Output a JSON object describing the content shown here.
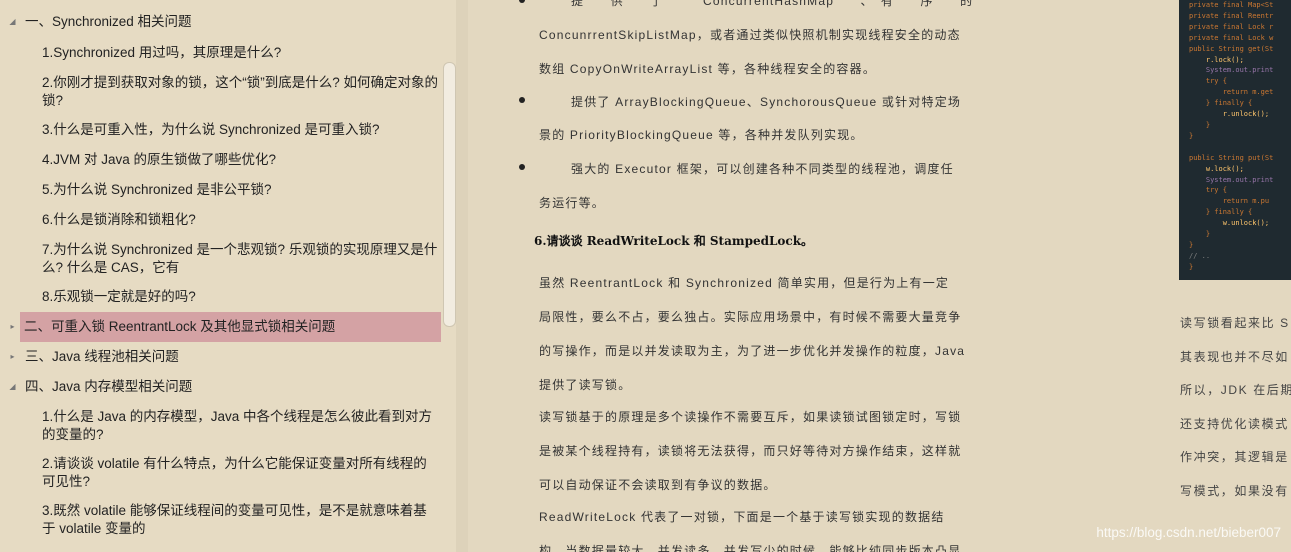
{
  "toc": {
    "sections": [
      {
        "label": "一、Synchronized 相关问题",
        "expanded": true
      },
      {
        "label": "二、可重入锁 ReentrantLock 及其他显式锁相关问题",
        "expanded": false,
        "active": true
      },
      {
        "label": "三、Java 线程池相关问题",
        "expanded": false
      },
      {
        "label": "四、Java 内存模型相关问题",
        "expanded": true
      }
    ],
    "section1_items": [
      "1.Synchronized 用过吗，其原理是什么?",
      "2.你刚才提到获取对象的锁，这个“锁”到底是什么? 如何确定对象的锁?",
      "3.什么是可重入性，为什么说 Synchronized 是可重入锁?",
      "4.JVM 对 Java 的原生锁做了哪些优化?",
      "5.为什么说 Synchronized 是非公平锁?",
      "6.什么是锁消除和锁粗化?",
      "7.为什么说 Synchronized 是一个悲观锁? 乐观锁的实现原理又是什么? 什么是 CAS，它有",
      "8.乐观锁一定就是好的吗?"
    ],
    "section4_items": [
      "1.什么是 Java 的内存模型，Java 中各个线程是怎么彼此看到对方的变量的?",
      "2.请谈谈 volatile 有什么特点，为什么它能保证变量对所有线程的可见性?",
      "3.既然 volatile 能够保证线程间的变量可见性，是不是就意味着基于 volatile 变量的"
    ]
  },
  "document": {
    "bullet1": [
      "提　　供　　了　　　ConcurrentHashMap　　、　有　　序　　的",
      "ConcunrrentSkipListMap，或者通过类似快照机制实现线程安全的动态",
      "数组 CopyOnWriteArrayList 等，各种线程安全的容器。"
    ],
    "bullet2": [
      "提供了 ArrayBlockingQueue、SynchorousQueue 或针对特定场",
      "景的 PriorityBlockingQueue 等，各种并发队列实现。"
    ],
    "bullet3": [
      "强大的 Executor 框架，可以创建各种不同类型的线程池，调度任",
      "务运行等。"
    ],
    "heading": "6.请谈谈 ReadWriteLock 和 StampedLock。",
    "para1": [
      "虽然 ReentrantLock 和 Synchronized 简单实用，但是行为上有一定",
      "局限性，要么不占，要么独占。实际应用场景中，有时候不需要大量竞争",
      "的写操作，而是以并发读取为主，为了进一步优化并发操作的粒度，Java",
      "提供了读写锁。"
    ],
    "para2": [
      "读写锁基于的原理是多个读操作不需要互斥，如果读锁试图锁定时，写锁",
      "是被某个线程持有，读锁将无法获得，而只好等待对方操作结束，这样就",
      "可以自动保证不会读取到有争议的数据。"
    ],
    "para3": [
      "ReadWriteLock 代表了一对锁，下面是一个基于读写锁实现的数据结",
      "构，当数据量较大，并发读多、并发写少的时候，能够比纯同步版本凸显"
    ]
  },
  "right": {
    "code_lines": [
      "private final Map<St",
      "private final Reentr",
      "private final Lock r",
      "private final Lock w",
      "public String get(St",
      "    r.lock();",
      "    System.out.print",
      "    try {",
      "        return m.get",
      "    } finally {",
      "        r.unlock();",
      "    }",
      "}",
      "",
      "public String put(St",
      "    w.lock();",
      "    System.out.print",
      "    try {",
      "        return m.pu",
      "    } finally {",
      "        w.unlock();",
      "    }",
      "}",
      "// ..",
      "}"
    ],
    "text_lines": [
      "读写锁看起来比 S",
      "其表现也并不尽如",
      "所以，JDK 在后期",
      "还支持优化读模式",
      "作冲突，其逻辑是",
      "写模式，如果没有"
    ],
    "watermark": "https://blog.csdn.net/bieber007"
  },
  "colors": {
    "background": "#e3d8c0",
    "active_item": "#d4a2a4",
    "code_bg": "#1f2a30"
  }
}
